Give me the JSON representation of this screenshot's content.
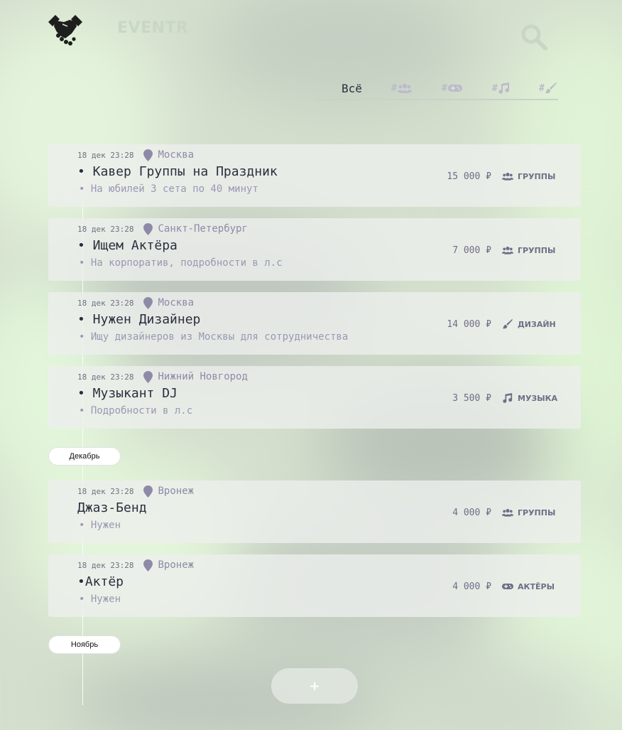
{
  "header": {
    "brand": "EVENTR",
    "logo_icon": "handshake-icon",
    "search_icon": "search-icon"
  },
  "tabs": [
    {
      "label": "Всё",
      "active": true
    },
    {
      "label": "#",
      "icon": "users-icon"
    },
    {
      "label": "#",
      "icon": "gamepad-icon"
    },
    {
      "label": "#",
      "icon": "music-icon"
    },
    {
      "label": "#",
      "icon": "paintbrush-icon"
    }
  ],
  "events": [
    {
      "date": "18 дек 23:28",
      "city": "Москва",
      "title": "• Кавер Группы на Праздник",
      "description": "• На юбилей 3 сета по 40 минут",
      "price": "15 000 ₽",
      "category": "ГРУППЫ",
      "category_icon": "users-icon"
    },
    {
      "date": "18 дек 23:28",
      "city": "Санкт-Петербург",
      "title": "• Ищем Актёра",
      "description": "• На корпоратив, подробности в л.с",
      "price": "7 000 ₽",
      "category": "ГРУППЫ",
      "category_icon": "users-icon"
    },
    {
      "date": "18 дек 23:28",
      "city": "Москва",
      "title": "• Нужен Дизайнер",
      "description": "• Ищу дизайнеров из Москвы для сотрудничества",
      "price": "14 000 ₽",
      "category": "ДИЗАЙН",
      "category_icon": "paintbrush-icon"
    },
    {
      "date": "18 дек 23:28",
      "city": "Нижний Новгород",
      "title": "• Музыкант DJ",
      "description": "• Подробности в л.с",
      "price": "3 500 ₽",
      "category": "МУЗЫКА",
      "category_icon": "music-icon"
    },
    {
      "date": "18 дек 23:28",
      "city": "Вронеж",
      "title": "Джаз-Бенд",
      "description": "• Нужен",
      "price": "4 000 ₽",
      "category": "ГРУППЫ",
      "category_icon": "users-icon"
    },
    {
      "date": "18 дек 23:28",
      "city": "Вронеж",
      "title": "•Актёр",
      "description": "• Нужен",
      "price": "4 000 ₽",
      "category": "АКТЁРЫ",
      "category_icon": "gamepad-icon"
    }
  ],
  "months": [
    "Декабрь",
    "Ноябрь"
  ],
  "add_button": "+",
  "colors": {
    "background": "#d3dfcc",
    "text_dark": "#2c2e3e",
    "muted": "#9a98b2",
    "accent": "#8d8aa8"
  }
}
